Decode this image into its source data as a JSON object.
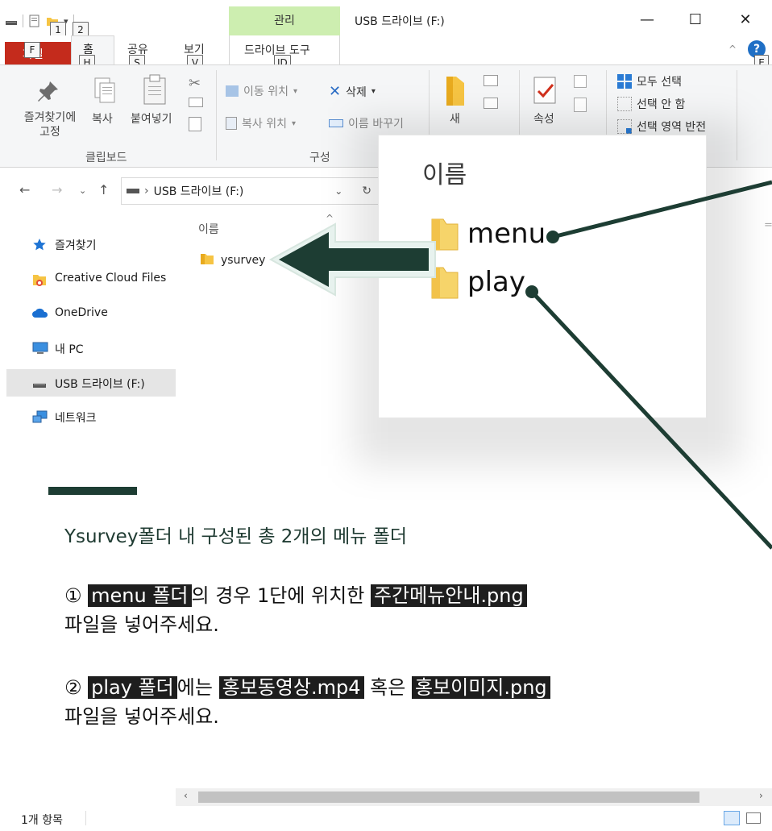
{
  "window": {
    "title": "USB 드라이브 (F:)",
    "context_tab_group": "관리",
    "minimize": "—",
    "maximize": "☐",
    "close": "✕"
  },
  "keytips": {
    "qat1": "1",
    "qat2": "2",
    "file": "F",
    "home": "H",
    "share": "S",
    "view": "V",
    "drive": "JD",
    "help": "E"
  },
  "tabs": {
    "file": "파일",
    "home": "홈",
    "share": "공유",
    "view": "보기",
    "drive_tools": "드라이브 도구"
  },
  "ribbon": {
    "pin_quick": "즐겨찾기에\n고정",
    "copy": "복사",
    "paste": "붙여넣기",
    "move_to": "이동 위치",
    "copy_to": "복사 위치",
    "delete": "삭제",
    "rename": "이름 바꾸기",
    "new": "새",
    "properties": "속성",
    "select_all": "모두 선택",
    "select_none": "선택 안 함",
    "invert_selection": "선택 영역 반전",
    "group_clipboard": "클립보드",
    "group_organize": "구성"
  },
  "address": {
    "path": "USB 드라이브 (F:)"
  },
  "sidebar": {
    "items": [
      {
        "label": "즐겨찾기"
      },
      {
        "label": "Creative Cloud Files"
      },
      {
        "label": "OneDrive"
      },
      {
        "label": "내 PC"
      },
      {
        "label": "USB 드라이브 (F:)"
      },
      {
        "label": "네트워크"
      }
    ]
  },
  "content": {
    "column_name": "이름",
    "folder": "ysurvey"
  },
  "status": {
    "count": "1개 항목"
  },
  "zoom": {
    "header": "이름",
    "folders": [
      "menu",
      "play"
    ]
  },
  "instructions": {
    "title": "Ysurvey폴더 내 구성된 총 2개의 메뉴 폴더",
    "p1_num": "①",
    "p1_hl1": "menu 폴더",
    "p1_mid": "의 경우 1단에 위치한",
    "p1_hl2": "주간메뉴안내.png",
    "p1_line2": "파일을 넣어주세요.",
    "p2_num": "②",
    "p2_hl1": "play 폴더",
    "p2_mid1": "에는",
    "p2_hl2": "홍보동영상.mp4",
    "p2_mid2": "혹은",
    "p2_hl3": "홍보이미지.png",
    "p2_line2": "파일을 넣어주세요."
  },
  "colors": {
    "accent_dark_green": "#1d3d33",
    "file_tab_red": "#c42b1c",
    "context_tab_green": "#cdeeb0",
    "highlight_black": "#1e1e1e"
  }
}
